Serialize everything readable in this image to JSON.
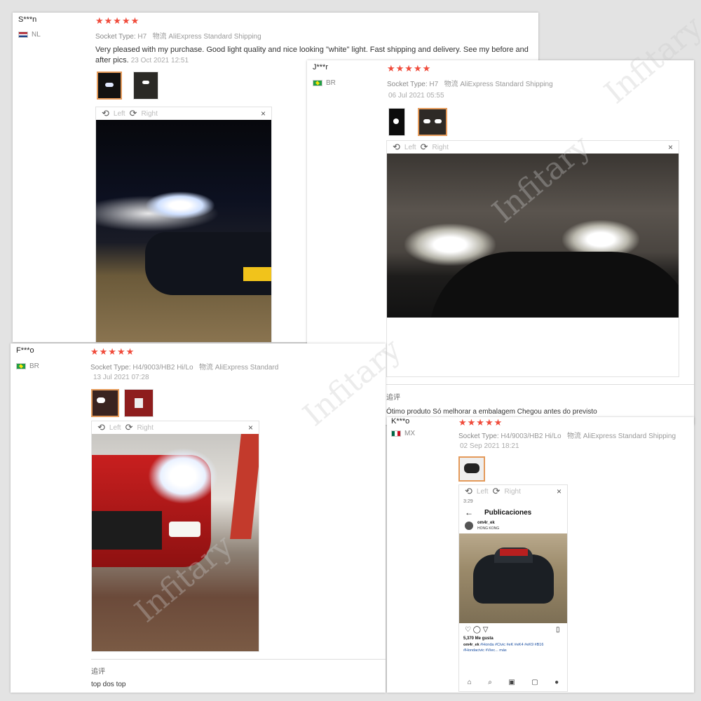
{
  "reviews": [
    {
      "user": "S***n",
      "country": "NL",
      "stars": "★★★★★",
      "socket_label": "Socket Type:",
      "socket_value": "H7",
      "shipping_prefix": "物流",
      "shipping": "AliExpress Standard Shipping",
      "text": "Very pleased with my purchase. Good light quality and nice looking \"white\" light. Fast shipping and delivery. See my before and after pics.",
      "date": "23 Oct 2021 12:51"
    },
    {
      "user": "J***r",
      "country": "BR",
      "stars": "★★★★★",
      "socket_label": "Socket Type:",
      "socket_value": "H7",
      "shipping_prefix": "物流",
      "shipping": "AliExpress Standard Shipping",
      "date": "06 Jul 2021 05:55",
      "followup_label": "追评",
      "followup_text": "Ótimo produto Só melhorar a embalagem Chegou antes do previsto"
    },
    {
      "user": "F***o",
      "country": "BR",
      "stars": "★★★★★",
      "socket_label": "Socket Type:",
      "socket_value": "H4/9003/HB2 Hi/Lo",
      "shipping_prefix": "物流",
      "shipping": "AliExpress Standard",
      "date": "13 Jul 2021 07:28",
      "followup_label": "追评",
      "followup_text": "top dos top"
    },
    {
      "user": "K***o",
      "country": "MX",
      "stars": "★★★★★",
      "socket_label": "Socket Type:",
      "socket_value": "H4/9003/HB2 Hi/Lo",
      "shipping_prefix": "物流",
      "shipping": "AliExpress Standard Shipping",
      "date": "02 Sep 2021 18:21"
    }
  ],
  "viewer": {
    "left": "Left",
    "right": "Right",
    "close": "×"
  },
  "phone": {
    "status_time": "3:29",
    "title": "Publicaciones",
    "account": "om4r_ek",
    "location": "HONG KONG",
    "likes": "5,370 Me gusta",
    "caption_user": "om4r_ek",
    "caption_tags": "#Honda #Civic #eK #eK4 #eK9 #B16 #Hondacivic #Viec... más"
  },
  "watermark": "Infitary"
}
